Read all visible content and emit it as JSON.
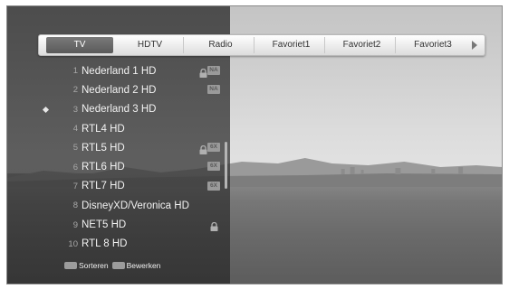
{
  "tabs": [
    {
      "label": "TV",
      "active": true
    },
    {
      "label": "HDTV",
      "active": false
    },
    {
      "label": "Radio",
      "active": false
    },
    {
      "label": "Favoriet1",
      "active": false
    },
    {
      "label": "Favoriet2",
      "active": false
    },
    {
      "label": "Favoriet3",
      "active": false
    }
  ],
  "channels": [
    {
      "number": "1",
      "name": "Nederland 1 HD",
      "locked": true,
      "badge": "NA",
      "current": false
    },
    {
      "number": "2",
      "name": "Nederland 2 HD",
      "locked": false,
      "badge": "NA",
      "current": false
    },
    {
      "number": "3",
      "name": "Nederland 3 HD",
      "locked": false,
      "badge": "",
      "current": true
    },
    {
      "number": "4",
      "name": "RTL4 HD",
      "locked": false,
      "badge": "",
      "current": false
    },
    {
      "number": "5",
      "name": "RTL5 HD",
      "locked": true,
      "badge": "6X",
      "current": false
    },
    {
      "number": "6",
      "name": "RTL6 HD",
      "locked": false,
      "badge": "6X",
      "current": false
    },
    {
      "number": "7",
      "name": "RTL7 HD",
      "locked": false,
      "badge": "6X",
      "current": false
    },
    {
      "number": "8",
      "name": "DisneyXD/Veronica HD",
      "locked": false,
      "badge": "",
      "current": false
    },
    {
      "number": "9",
      "name": "NET5 HD",
      "locked": true,
      "badge": "",
      "current": false
    },
    {
      "number": "10",
      "name": "RTL 8 HD",
      "locked": false,
      "badge": "",
      "current": false
    }
  ],
  "legend": {
    "sort_label": "Sorteren",
    "edit_label": "Bewerken"
  },
  "icons": {
    "lock": "lock-icon",
    "next": "chevron-right-icon",
    "current": "diamond-marker-icon"
  }
}
